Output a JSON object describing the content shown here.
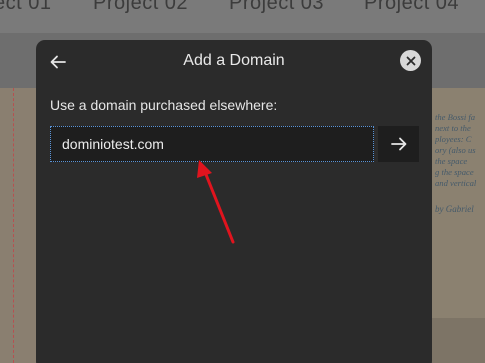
{
  "background": {
    "tabs": [
      "ect 01",
      "Project 02",
      "Project 03",
      "Project 04"
    ],
    "text_lines": [
      "the Bossi fa",
      "next to the",
      "ployees: C",
      "ory (also us",
      "the space",
      "g the space",
      "and vertical"
    ],
    "credit": "by Gabriel"
  },
  "modal": {
    "title": "Add a Domain",
    "back_icon": "arrow-left-icon",
    "close_icon": "close-icon",
    "label": "Use a domain purchased elsewhere:",
    "input_value": "dominiotest.com",
    "submit_icon": "arrow-right-icon"
  },
  "annotation": {
    "color": "#e0141e"
  },
  "colors": {
    "modal_bg": "#2b2b2b",
    "input_bg": "#1e1e1e",
    "focus_border": "#5a93d6"
  }
}
